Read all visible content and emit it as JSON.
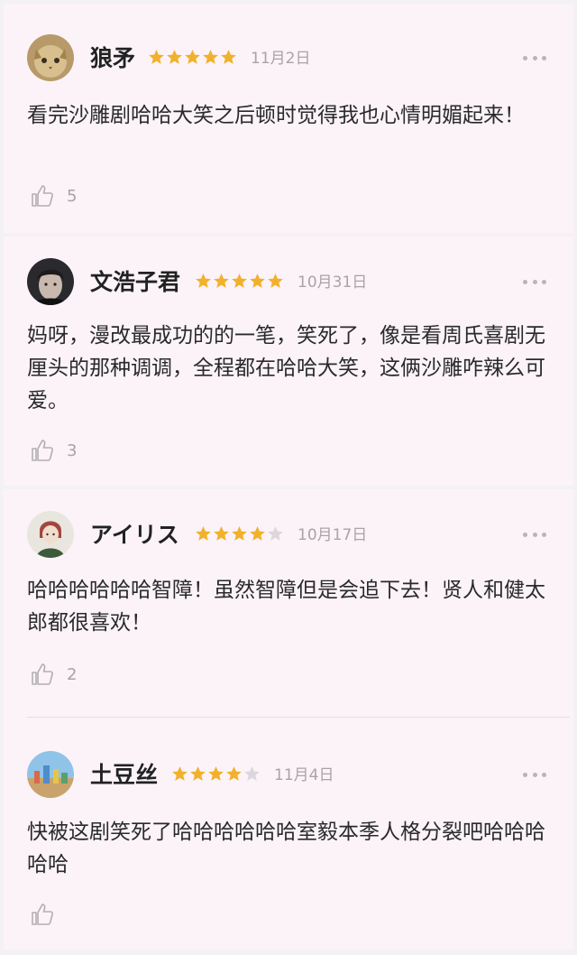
{
  "colors": {
    "star_filled": "#f2b12c",
    "star_empty": "#dcd7dc",
    "muted": "#a8a3a8",
    "card_bg": "#fbf3f8"
  },
  "reviews": [
    {
      "name": "狼矛",
      "rating": 5,
      "date": "11月2日",
      "text": "看完沙雕剧哈哈大笑之后顿时觉得我也心情明媚起来！",
      "likes": "5",
      "avatar": "cat-avatar"
    },
    {
      "name": "文浩子君",
      "rating": 5,
      "date": "10月31日",
      "text": "妈呀，漫改最成功的的一笔，笑死了，像是看周氏喜剧无厘头的那种调调，全程都在哈哈大笑，这俩沙雕咋辣么可爱。",
      "likes": "3",
      "avatar": "person-avatar"
    },
    {
      "name": "アイリス",
      "rating": 4,
      "date": "10月17日",
      "text": "哈哈哈哈哈哈智障！虽然智障但是会追下去！贤人和健太郎都很喜欢！",
      "likes": "2",
      "avatar": "illustration-avatar"
    },
    {
      "name": "土豆丝",
      "rating": 4,
      "date": "11月4日",
      "text": "快被这剧笑死了哈哈哈哈哈哈室毅本季人格分裂吧哈哈哈哈哈",
      "likes": "",
      "avatar": "landscape-avatar"
    }
  ]
}
